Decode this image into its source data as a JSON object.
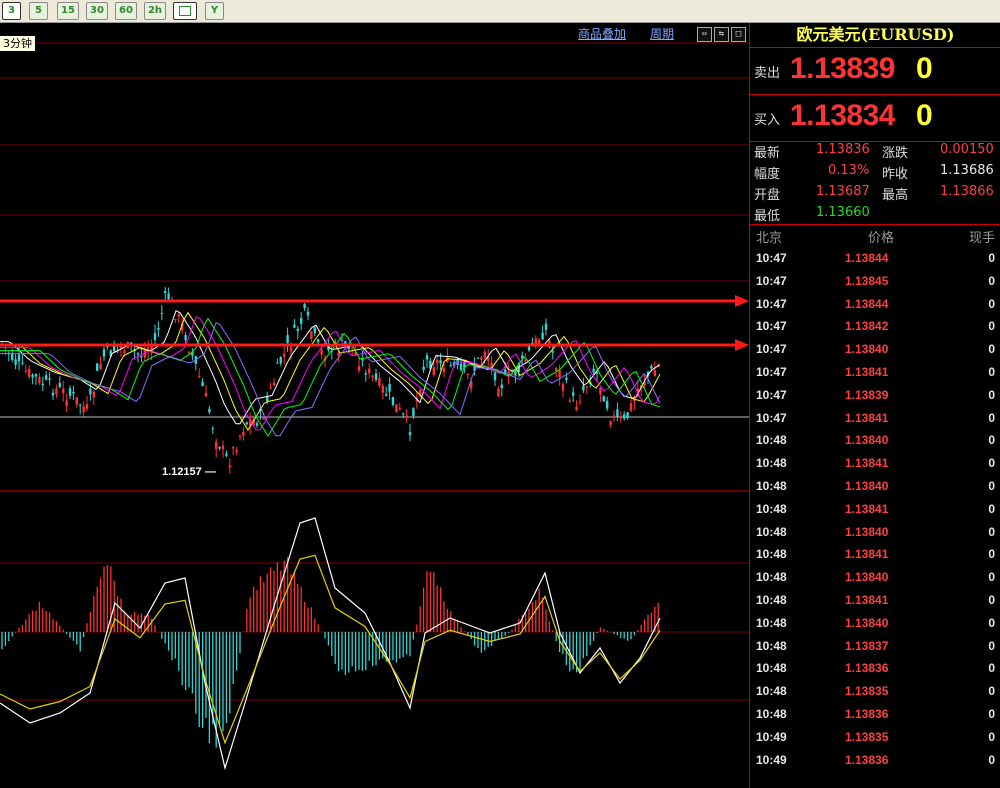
{
  "toolbar": {
    "buttons": [
      "3",
      "5",
      "15",
      "30",
      "60",
      "2h",
      "",
      "Y"
    ],
    "selected": "3"
  },
  "chart": {
    "period_label": "3分钟",
    "overlay_link": "商品叠加",
    "cycle_link": "周期",
    "low_label": "1.12157"
  },
  "panel": {
    "title": "欧元美元(EURUSD)",
    "sell": {
      "label": "卖出",
      "price": "1.13839",
      "volume": "0"
    },
    "buy": {
      "label": "买入",
      "price": "1.13834",
      "volume": "0"
    },
    "stats": {
      "latest_label": "最新",
      "latest": "1.13836",
      "change_label": "涨跌",
      "change": "0.00150",
      "amplitude_label": "幅度",
      "amplitude": "0.13%",
      "prev_close_label": "昨收",
      "prev_close": "1.13686",
      "open_label": "开盘",
      "open": "1.13687",
      "high_label": "最高",
      "high": "1.13866",
      "low_label": "最低",
      "low": "1.13660"
    },
    "feed_headers": {
      "time": "北京",
      "price": "价格",
      "volume": "现手"
    },
    "feed": [
      {
        "time": "10:47",
        "price": "1.13844",
        "vol": "0"
      },
      {
        "time": "10:47",
        "price": "1.13845",
        "vol": "0"
      },
      {
        "time": "10:47",
        "price": "1.13844",
        "vol": "0"
      },
      {
        "time": "10:47",
        "price": "1.13842",
        "vol": "0"
      },
      {
        "time": "10:47",
        "price": "1.13840",
        "vol": "0"
      },
      {
        "time": "10:47",
        "price": "1.13841",
        "vol": "0"
      },
      {
        "time": "10:47",
        "price": "1.13839",
        "vol": "0"
      },
      {
        "time": "10:47",
        "price": "1.13841",
        "vol": "0"
      },
      {
        "time": "10:48",
        "price": "1.13840",
        "vol": "0"
      },
      {
        "time": "10:48",
        "price": "1.13841",
        "vol": "0"
      },
      {
        "time": "10:48",
        "price": "1.13840",
        "vol": "0"
      },
      {
        "time": "10:48",
        "price": "1.13841",
        "vol": "0"
      },
      {
        "time": "10:48",
        "price": "1.13840",
        "vol": "0"
      },
      {
        "time": "10:48",
        "price": "1.13841",
        "vol": "0"
      },
      {
        "time": "10:48",
        "price": "1.13840",
        "vol": "0"
      },
      {
        "time": "10:48",
        "price": "1.13841",
        "vol": "0"
      },
      {
        "time": "10:48",
        "price": "1.13840",
        "vol": "0"
      },
      {
        "time": "10:48",
        "price": "1.13837",
        "vol": "0"
      },
      {
        "time": "10:48",
        "price": "1.13836",
        "vol": "0"
      },
      {
        "time": "10:48",
        "price": "1.13835",
        "vol": "0"
      },
      {
        "time": "10:48",
        "price": "1.13836",
        "vol": "0"
      },
      {
        "time": "10:49",
        "price": "1.13835",
        "vol": "0"
      },
      {
        "time": "10:49",
        "price": "1.13836",
        "vol": "0"
      }
    ]
  },
  "colors": {
    "up": "#ff3030",
    "down": "#2fd6d6",
    "grid": "#7a0000",
    "arrow": "#ff1a1a"
  }
}
